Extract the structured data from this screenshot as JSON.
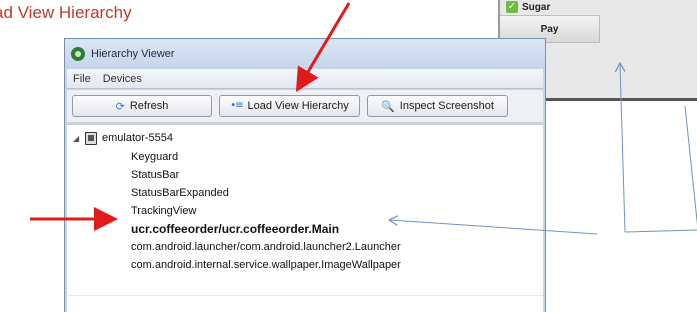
{
  "caption": "ad View Hierarchy",
  "phone": {
    "sugar_check": "✓",
    "sugar_label": "Sugar",
    "pay_label": "Pay"
  },
  "window": {
    "title": "Hierarchy Viewer",
    "menu": [
      "File",
      "Devices"
    ],
    "toolbar": {
      "refresh_label": "Refresh",
      "load_label": "Load View Hierarchy",
      "inspect_label": "Inspect Screenshot"
    },
    "tree": {
      "device": "emulator-5554",
      "expander": "◢",
      "windows": [
        "Keyguard",
        "StatusBar",
        "StatusBarExpanded",
        "TrackingView",
        "ucr.coffeeorder/ucr.coffeeorder.Main",
        "com.android.launcher/com.android.launcher2.Launcher",
        "com.android.internal.service.wallpaper.ImageWallpaper"
      ],
      "selected_index": 4
    }
  },
  "colors": {
    "red_arrow": "#e01b1b",
    "blue_arrow": "#6f93c4",
    "caption": "#c0392b"
  },
  "icons": {
    "refresh": "refresh-icon",
    "load": "load-hierarchy-icon",
    "inspect": "magnifier-icon",
    "device": "device-icon"
  }
}
